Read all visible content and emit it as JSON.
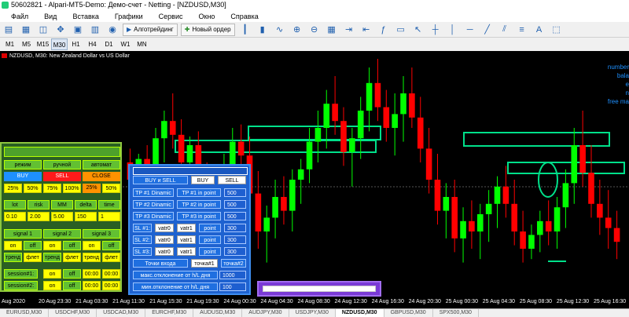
{
  "window": {
    "title": "50602821 - Alpari-MT5-Demo: Демо-счет - Netting - [NZDUSD,M30]"
  },
  "menu": [
    "Файл",
    "Вид",
    "Вставка",
    "Графики",
    "Сервис",
    "Окно",
    "Справка"
  ],
  "toolbar": {
    "algo_label": "Алготрейдинг",
    "new_order_label": "Новый ордер"
  },
  "timeframes": [
    "M1",
    "M5",
    "M15",
    "M30",
    "H1",
    "H4",
    "D1",
    "W1",
    "MN"
  ],
  "active_timeframe": "M30",
  "chart": {
    "symbol_title": "NZDUSD, M30:  New Zealand Dollar vs US Dollar",
    "right_info": [
      "number",
      "bala",
      "e",
      "n",
      "free ma"
    ],
    "x_labels": [
      "Aug 2020",
      "20 Aug 23:30",
      "21 Aug 03:30",
      "21 Aug 11:30",
      "21 Aug 15:30",
      "21 Aug 19:30",
      "24 Aug 00:30",
      "24 Aug 04:30",
      "24 Aug 08:30",
      "24 Aug 12:30",
      "24 Aug 16:30",
      "24 Aug 20:30",
      "25 Aug 00:30",
      "25 Aug 04:30",
      "25 Aug 08:30",
      "25 Aug 12:30",
      "25 Aug 16:30"
    ],
    "candles": [
      {
        "o": 60,
        "h": 52,
        "l": 88,
        "c": 70
      },
      {
        "o": 70,
        "h": 55,
        "l": 90,
        "c": 58
      },
      {
        "o": 58,
        "h": 50,
        "l": 72,
        "c": 66
      },
      {
        "o": 66,
        "h": 40,
        "l": 80,
        "c": 46
      },
      {
        "o": 46,
        "h": 30,
        "l": 60,
        "c": 36
      },
      {
        "o": 36,
        "h": 20,
        "l": 52,
        "c": 44
      },
      {
        "o": 44,
        "h": 35,
        "l": 70,
        "c": 60
      },
      {
        "o": 60,
        "h": 45,
        "l": 78,
        "c": 50
      },
      {
        "o": 50,
        "h": 42,
        "l": 82,
        "c": 74
      },
      {
        "o": 74,
        "h": 60,
        "l": 100,
        "c": 90
      },
      {
        "o": 90,
        "h": 70,
        "l": 105,
        "c": 76
      },
      {
        "o": 76,
        "h": 55,
        "l": 88,
        "c": 62
      },
      {
        "o": 62,
        "h": 40,
        "l": 78,
        "c": 48
      },
      {
        "o": 48,
        "h": 38,
        "l": 64,
        "c": 56
      },
      {
        "o": 56,
        "h": 45,
        "l": 85,
        "c": 78
      },
      {
        "o": 78,
        "h": 65,
        "l": 110,
        "c": 100
      },
      {
        "o": 100,
        "h": 85,
        "l": 118,
        "c": 92
      },
      {
        "o": 92,
        "h": 70,
        "l": 104,
        "c": 80
      },
      {
        "o": 80,
        "h": 68,
        "l": 96,
        "c": 88
      },
      {
        "o": 88,
        "h": 64,
        "l": 100,
        "c": 70
      },
      {
        "o": 70,
        "h": 58,
        "l": 84,
        "c": 64
      },
      {
        "o": 64,
        "h": 40,
        "l": 72,
        "c": 48
      },
      {
        "o": 48,
        "h": 30,
        "l": 60,
        "c": 40
      },
      {
        "o": 40,
        "h": 18,
        "l": 52,
        "c": 26
      },
      {
        "o": 26,
        "h": 10,
        "l": 44,
        "c": 36
      },
      {
        "o": 36,
        "h": 28,
        "l": 62,
        "c": 54
      },
      {
        "o": 54,
        "h": 40,
        "l": 74,
        "c": 46
      },
      {
        "o": 46,
        "h": 22,
        "l": 58,
        "c": 30
      },
      {
        "o": 30,
        "h": 5,
        "l": 42,
        "c": 14
      },
      {
        "o": 14,
        "h": 0,
        "l": 36,
        "c": 28
      },
      {
        "o": 28,
        "h": 18,
        "l": 48,
        "c": 40
      },
      {
        "o": 40,
        "h": 20,
        "l": 56,
        "c": 32
      },
      {
        "o": 32,
        "h": 10,
        "l": 48,
        "c": 20
      },
      {
        "o": 20,
        "h": 5,
        "l": 40,
        "c": 34
      },
      {
        "o": 34,
        "h": 22,
        "l": 60,
        "c": 52
      },
      {
        "o": 52,
        "h": 40,
        "l": 78,
        "c": 70
      },
      {
        "o": 70,
        "h": 55,
        "l": 96,
        "c": 88
      },
      {
        "o": 88,
        "h": 72,
        "l": 104,
        "c": 80
      },
      {
        "o": 80,
        "h": 70,
        "l": 112,
        "c": 104
      },
      {
        "o": 104,
        "h": 86,
        "l": 118,
        "c": 94
      },
      {
        "o": 94,
        "h": 82,
        "l": 110,
        "c": 100
      },
      {
        "o": 100,
        "h": 84,
        "l": 116,
        "c": 90
      },
      {
        "o": 90,
        "h": 76,
        "l": 106,
        "c": 84
      },
      {
        "o": 84,
        "h": 68,
        "l": 98,
        "c": 74
      },
      {
        "o": 74,
        "h": 62,
        "l": 92,
        "c": 84
      },
      {
        "o": 84,
        "h": 70,
        "l": 108,
        "c": 100
      },
      {
        "o": 100,
        "h": 88,
        "l": 118,
        "c": 110
      },
      {
        "o": 110,
        "h": 96,
        "l": 116,
        "c": 102
      },
      {
        "o": 102,
        "h": 88,
        "l": 112,
        "c": 94
      },
      {
        "o": 94,
        "h": 82,
        "l": 108,
        "c": 100
      },
      {
        "o": 100,
        "h": 80,
        "l": 110,
        "c": 86
      },
      {
        "o": 86,
        "h": 64,
        "l": 98,
        "c": 72
      },
      {
        "o": 72,
        "h": 40,
        "l": 84,
        "c": 50
      },
      {
        "o": 50,
        "h": 30,
        "l": 74,
        "c": 66
      },
      {
        "o": 66,
        "h": 50,
        "l": 92,
        "c": 84
      },
      {
        "o": 84,
        "h": 70,
        "l": 102,
        "c": 92
      },
      {
        "o": 92,
        "h": 76,
        "l": 110,
        "c": 98
      },
      {
        "o": 98,
        "h": 88,
        "l": 116,
        "c": 106
      }
    ]
  },
  "panel1": {
    "row1": [
      "режим",
      "ручной",
      "автомат"
    ],
    "row2": [
      "BUY",
      "SELL",
      "CLOSE"
    ],
    "row3": [
      "25%",
      "50%",
      "75%",
      "100%",
      "25%",
      "50%"
    ],
    "row4": [
      "lot",
      "risk",
      "MM",
      "delta",
      "time"
    ],
    "row5": [
      "0.10",
      "2.00",
      "5.00",
      "150",
      "1"
    ],
    "row6": [
      "signal 1",
      "signal 2",
      "signal 3"
    ],
    "row7": [
      "on",
      "off",
      "on",
      "off",
      "on",
      "off"
    ],
    "row8": [
      "тренд",
      "флет",
      "тренд",
      "флет",
      "тренд",
      "флет"
    ],
    "sess1": [
      "session#1:",
      "on",
      "off",
      "00:00",
      "00:00"
    ],
    "sess2": [
      "session#2:",
      "on",
      "off",
      "00:00",
      "00:00"
    ]
  },
  "panel2": {
    "top": [
      "BUY и SELL",
      "BUY",
      "SELL"
    ],
    "tp": [
      {
        "name": "TP #1 Dinamic",
        "mode": "TP #1 in point",
        "val": "500"
      },
      {
        "name": "TP #2 Dinamic",
        "mode": "TP #2 in point",
        "val": "500"
      },
      {
        "name": "TP #3 Dinamic",
        "mode": "TP #3 in point",
        "val": "500"
      }
    ],
    "sl": [
      {
        "name": "SL #1:",
        "a": "vatr0",
        "b": "vatr1",
        "c": "point",
        "val": "300"
      },
      {
        "name": "SL #2:",
        "a": "vatr0",
        "b": "vatr1",
        "c": "point",
        "val": "300"
      },
      {
        "name": "SL #3:",
        "a": "vatr0",
        "b": "vatr1",
        "c": "point",
        "val": "300"
      }
    ],
    "entry": [
      "Точки входа",
      "точка#1",
      "точка#2"
    ],
    "dev_max": {
      "label": "макс.отклонение от h/L дня",
      "val": "1000"
    },
    "dev_min": {
      "label": "мин.отклонение от h/L дня",
      "val": "100"
    }
  },
  "bottom_tabs": [
    "EURUSD,M30",
    "USDCHF,M30",
    "USDCAD,M30",
    "EURCHF,M30",
    "AUDUSD,M30",
    "AUDJPY,M30",
    "USDJPY,M30",
    "NZDUSD,M30",
    "GBPUSD,M30",
    "SPX500,M30"
  ],
  "active_tab": "NZDUSD,M30",
  "colors": {
    "bull": "#00ff00",
    "bear": "#ff0000",
    "levels": "#00e08a",
    "ellipse": "#00e08a",
    "panel_green": "#2a5f23",
    "panel_blue": "#1e62d0",
    "purple": "#7a3ad6"
  }
}
